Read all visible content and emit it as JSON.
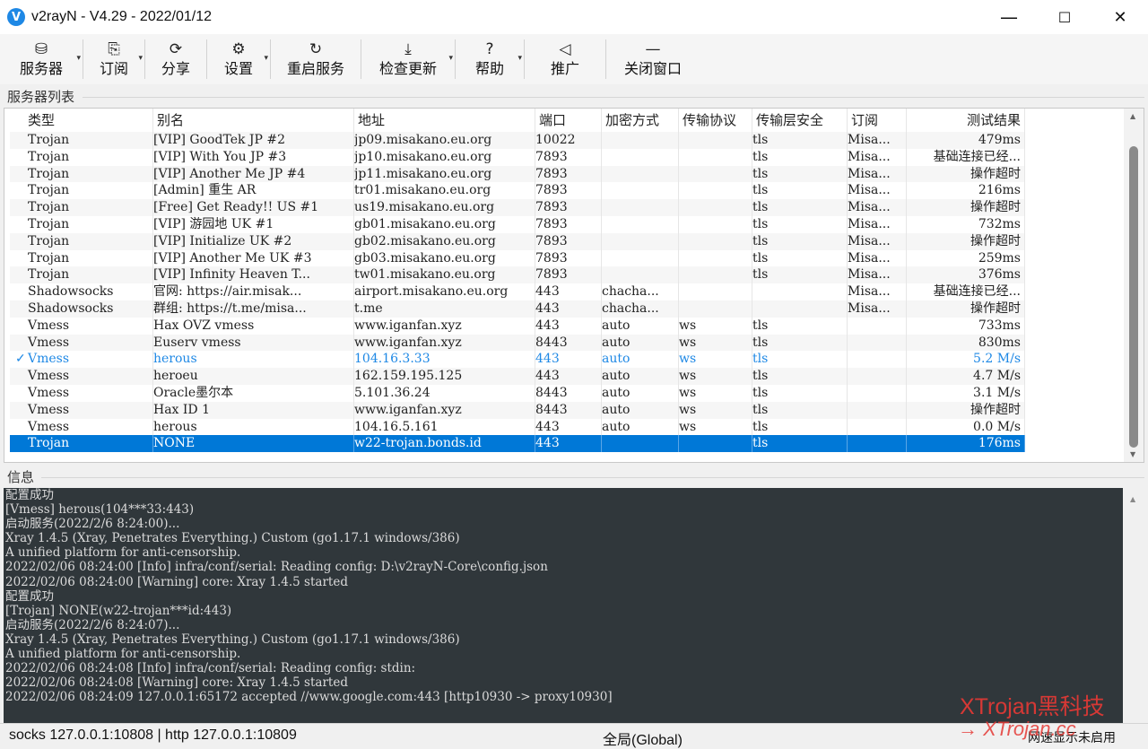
{
  "window": {
    "title": "v2rayN - V4.29 - 2022/01/12",
    "app_icon": "V",
    "minimize": "—",
    "maximize": "☐",
    "close": "✕"
  },
  "toolbar": [
    {
      "name": "server",
      "icon": "database-icon",
      "glyph": "⛁",
      "label": "服务器",
      "dropdown": true
    },
    {
      "name": "subscribe",
      "icon": "subscription-icon",
      "glyph": "⎘",
      "label": "订阅",
      "dropdown": true
    },
    {
      "name": "share",
      "icon": "share-icon",
      "glyph": "⟳",
      "label": "分享",
      "dropdown": false
    },
    {
      "name": "settings",
      "icon": "gear-icon",
      "glyph": "⚙",
      "label": "设置",
      "dropdown": true
    },
    {
      "name": "restart-service",
      "icon": "refresh-icon",
      "glyph": "↻",
      "label": "重启服务",
      "dropdown": false
    },
    {
      "name": "check-update",
      "icon": "download-icon",
      "glyph": "⤓",
      "label": "检查更新",
      "dropdown": true
    },
    {
      "name": "help",
      "icon": "help-icon",
      "glyph": "?",
      "label": "帮助",
      "dropdown": true
    },
    {
      "name": "promote",
      "icon": "speaker-icon",
      "glyph": "◁",
      "label": "推广",
      "dropdown": false
    },
    {
      "name": "close-window",
      "icon": "minimize-icon",
      "glyph": "—",
      "label": "关闭窗口",
      "dropdown": false
    }
  ],
  "server_list": {
    "label": "服务器列表",
    "columns": [
      "类型",
      "别名",
      "地址",
      "端口",
      "加密方式",
      "传输协议",
      "传输层安全",
      "订阅",
      "测试结果"
    ],
    "rows": [
      {
        "type": "Trojan",
        "alias": "[VIP] GoodTek JP #2",
        "address": "jp09.misakano.eu.org",
        "port": "10022",
        "security": "",
        "network": "",
        "tls": "tls",
        "sub": "Misa...",
        "result": "479ms"
      },
      {
        "type": "Trojan",
        "alias": "[VIP] With You JP #3",
        "address": "jp10.misakano.eu.org",
        "port": "7893",
        "security": "",
        "network": "",
        "tls": "tls",
        "sub": "Misa...",
        "result": "基础连接已经..."
      },
      {
        "type": "Trojan",
        "alias": "[VIP] Another Me JP #4",
        "address": "jp11.misakano.eu.org",
        "port": "7893",
        "security": "",
        "network": "",
        "tls": "tls",
        "sub": "Misa...",
        "result": "操作超时"
      },
      {
        "type": "Trojan",
        "alias": "[Admin] 重生 AR",
        "address": "tr01.misakano.eu.org",
        "port": "7893",
        "security": "",
        "network": "",
        "tls": "tls",
        "sub": "Misa...",
        "result": "216ms"
      },
      {
        "type": "Trojan",
        "alias": "[Free] Get Ready!! US #1",
        "address": "us19.misakano.eu.org",
        "port": "7893",
        "security": "",
        "network": "",
        "tls": "tls",
        "sub": "Misa...",
        "result": "操作超时"
      },
      {
        "type": "Trojan",
        "alias": "[VIP] 游园地 UK #1",
        "address": "gb01.misakano.eu.org",
        "port": "7893",
        "security": "",
        "network": "",
        "tls": "tls",
        "sub": "Misa...",
        "result": "732ms"
      },
      {
        "type": "Trojan",
        "alias": "[VIP] Initialize UK #2",
        "address": "gb02.misakano.eu.org",
        "port": "7893",
        "security": "",
        "network": "",
        "tls": "tls",
        "sub": "Misa...",
        "result": "操作超时"
      },
      {
        "type": "Trojan",
        "alias": "[VIP] Another Me UK #3",
        "address": "gb03.misakano.eu.org",
        "port": "7893",
        "security": "",
        "network": "",
        "tls": "tls",
        "sub": "Misa...",
        "result": "259ms"
      },
      {
        "type": "Trojan",
        "alias": "[VIP] Infinity Heaven T...",
        "address": "tw01.misakano.eu.org",
        "port": "7893",
        "security": "",
        "network": "",
        "tls": "tls",
        "sub": "Misa...",
        "result": "376ms"
      },
      {
        "type": "Shadowsocks",
        "alias": "官网: https://air.misak...",
        "address": "airport.misakano.eu.org",
        "port": "443",
        "security": "chacha...",
        "network": "",
        "tls": "",
        "sub": "Misa...",
        "result": "基础连接已经..."
      },
      {
        "type": "Shadowsocks",
        "alias": "群组: https://t.me/misa...",
        "address": "t.me",
        "port": "443",
        "security": "chacha...",
        "network": "",
        "tls": "",
        "sub": "Misa...",
        "result": "操作超时"
      },
      {
        "type": "Vmess",
        "alias": "Hax OVZ vmess",
        "address": "www.iganfan.xyz",
        "port": "443",
        "security": "auto",
        "network": "ws",
        "tls": "tls",
        "sub": "",
        "result": "733ms"
      },
      {
        "type": "Vmess",
        "alias": "Euserv vmess",
        "address": "www.iganfan.xyz",
        "port": "8443",
        "security": "auto",
        "network": "ws",
        "tls": "tls",
        "sub": "",
        "result": "830ms"
      },
      {
        "type": "Vmess",
        "alias": "herous",
        "address": "104.16.3.33",
        "port": "443",
        "security": "auto",
        "network": "ws",
        "tls": "tls",
        "sub": "",
        "result": "5.2 M/s",
        "active": true
      },
      {
        "type": "Vmess",
        "alias": "heroeu",
        "address": "162.159.195.125",
        "port": "443",
        "security": "auto",
        "network": "ws",
        "tls": "tls",
        "sub": "",
        "result": "4.7 M/s"
      },
      {
        "type": "Vmess",
        "alias": "Oracle墨尔本",
        "address": "5.101.36.24",
        "port": "8443",
        "security": "auto",
        "network": "ws",
        "tls": "tls",
        "sub": "",
        "result": "3.1 M/s"
      },
      {
        "type": "Vmess",
        "alias": "Hax ID 1",
        "address": "www.iganfan.xyz",
        "port": "8443",
        "security": "auto",
        "network": "ws",
        "tls": "tls",
        "sub": "",
        "result": "操作超时"
      },
      {
        "type": "Vmess",
        "alias": "herous",
        "address": "104.16.5.161",
        "port": "443",
        "security": "auto",
        "network": "ws",
        "tls": "tls",
        "sub": "",
        "result": "0.0 M/s"
      },
      {
        "type": "Trojan",
        "alias": "NONE",
        "address": "w22-trojan.bonds.id",
        "port": "443",
        "security": "",
        "network": "",
        "tls": "tls",
        "sub": "",
        "result": "176ms",
        "selected": true
      }
    ]
  },
  "log": {
    "label": "信息",
    "lines": [
      "配置成功",
      "[Vmess] herous(104***33:443)",
      "启动服务(2022/2/6 8:24:00)...",
      "Xray 1.4.5 (Xray, Penetrates Everything.) Custom (go1.17.1 windows/386)",
      "A unified platform for anti-censorship.",
      "2022/02/06 08:24:00 [Info] infra/conf/serial: Reading config: D:\\v2rayN-Core\\config.json",
      "2022/02/06 08:24:00 [Warning] core: Xray 1.4.5 started",
      "配置成功",
      "[Trojan] NONE(w22-trojan***id:443)",
      "启动服务(2022/2/6 8:24:07)...",
      "Xray 1.4.5 (Xray, Penetrates Everything.) Custom (go1.17.1 windows/386)",
      "A unified platform for anti-censorship.",
      "2022/02/06 08:24:08 [Info] infra/conf/serial: Reading config: stdin:",
      "2022/02/06 08:24:08 [Warning] core: Xray 1.4.5 started",
      "2022/02/06 08:24:09 127.0.0.1:65172 accepted //www.google.com:443 [http10930 -> proxy10930]"
    ]
  },
  "status": {
    "proxy": "socks 127.0.0.1:10808 | http 127.0.0.1:10809",
    "mode": "全局(Global)",
    "speed": "网速显示未启用"
  },
  "watermark": {
    "line1": "XTrojan黑科技",
    "line2": "→ XTrojan.cc"
  },
  "colors": {
    "accent": "#1e88e5",
    "selected": "#0078d7",
    "log_bg": "#30373b",
    "watermark": "#e53935"
  }
}
